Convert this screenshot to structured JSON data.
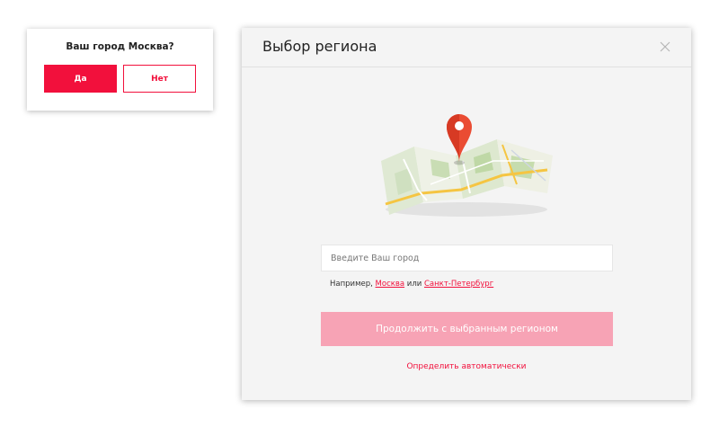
{
  "confirm": {
    "question": "Ваш город Москва?",
    "yes_label": "Да",
    "no_label": "Нет"
  },
  "modal": {
    "title": "Выбор региона",
    "input_placeholder": "Введите Ваш город",
    "example_prefix": "Например,",
    "example_city_1": "Москва",
    "example_separator": "или",
    "example_city_2": "Санкт-Петербург",
    "continue_label": "Продолжить с выбранным регионом",
    "auto_detect_label": "Определить автоматически"
  },
  "colors": {
    "accent": "#f2103c",
    "accent_disabled": "#f7a3b5",
    "modal_bg": "#f4f4f4"
  }
}
